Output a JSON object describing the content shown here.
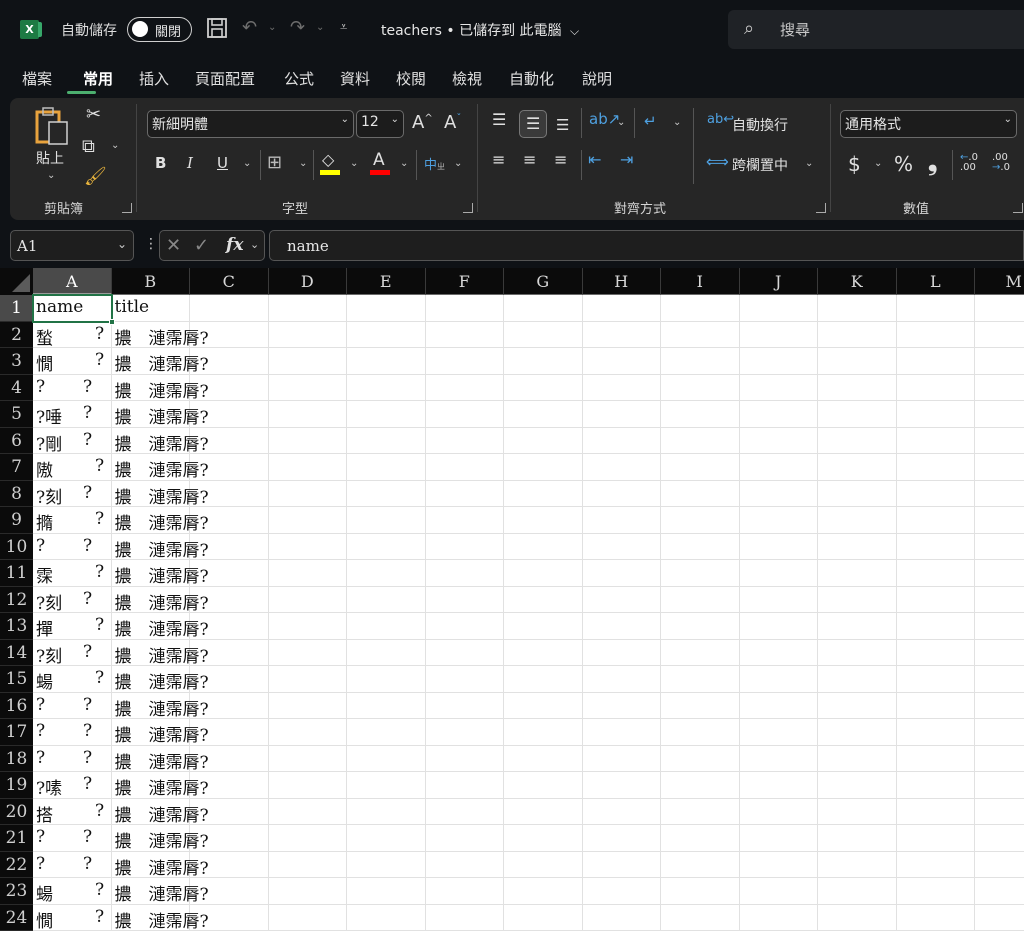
{
  "titlebar": {
    "app_icon": "excel-logo-icon",
    "autosave_label": "自動儲存",
    "autosave_state": "關閉",
    "document_title": "teachers • 已儲存到 此電腦",
    "search_placeholder": "搜尋"
  },
  "menu": {
    "tabs": [
      "檔案",
      "常用",
      "插入",
      "頁面配置",
      "公式",
      "資料",
      "校閱",
      "檢視",
      "自動化",
      "說明"
    ],
    "active": "常用"
  },
  "ribbon": {
    "clipboard": {
      "paste_label": "貼上",
      "group_label": "剪貼簿"
    },
    "font": {
      "font_name": "新細明體",
      "font_size": "12",
      "group_label": "字型",
      "fill_color": "#ffff00",
      "font_color": "#ff0000"
    },
    "alignment": {
      "wrap_text": "自動換行",
      "merge_center": "跨欄置中",
      "group_label": "對齊方式"
    },
    "number": {
      "format": "通用格式",
      "group_label": "數值",
      "currency": "$",
      "percent": "%",
      "comma": "❟"
    }
  },
  "formula_bar": {
    "name_box": "A1",
    "formula": "name"
  },
  "grid": {
    "columns": [
      "A",
      "B",
      "C",
      "D",
      "E",
      "F",
      "G",
      "H",
      "I",
      "J",
      "K",
      "L",
      "M"
    ],
    "selected_column": "A",
    "selected_cell": "A1",
    "header_row": {
      "num": "1",
      "A": "name",
      "B": "title"
    },
    "rows": [
      {
        "num": "2",
        "A": "蝵",
        "A_q": "?",
        "A_q_far": true,
        "B": "擃　漣霈脣?"
      },
      {
        "num": "3",
        "A": "憪",
        "A_q": "?",
        "A_q_far": true,
        "B": "擃　漣霈脣?"
      },
      {
        "num": "4",
        "A": "?",
        "A_q": "?",
        "A_q_far": false,
        "B": "擃　漣霈脣?"
      },
      {
        "num": "5",
        "A": "?唾",
        "A_q": "?",
        "A_q_far": false,
        "B": "擃　漣霈脣?"
      },
      {
        "num": "6",
        "A": "?剛",
        "A_q": "?",
        "A_q_far": false,
        "B": "擃　漣霈脣?"
      },
      {
        "num": "7",
        "A": "隞",
        "A_q": "?",
        "A_q_far": true,
        "B": "擃　漣霈脣?"
      },
      {
        "num": "8",
        "A": "?刻",
        "A_q": "?",
        "A_q_far": false,
        "B": "擃　漣霈脣?"
      },
      {
        "num": "9",
        "A": "撱",
        "A_q": "?",
        "A_q_far": true,
        "B": "擃　漣霈脣?"
      },
      {
        "num": "10",
        "A": "?",
        "A_q": "?",
        "A_q_far": false,
        "B": "擃　漣霈脣?"
      },
      {
        "num": "11",
        "A": "霂",
        "A_q": "?",
        "A_q_far": true,
        "B": "擃　漣霈脣?"
      },
      {
        "num": "12",
        "A": "?刻",
        "A_q": "?",
        "A_q_far": false,
        "B": "擃　漣霈脣?"
      },
      {
        "num": "13",
        "A": "撣",
        "A_q": "?",
        "A_q_far": true,
        "B": "擃　漣霈脣?"
      },
      {
        "num": "14",
        "A": "?刻",
        "A_q": "?",
        "A_q_far": false,
        "B": "擃　漣霈脣?"
      },
      {
        "num": "15",
        "A": "蝪",
        "A_q": "?",
        "A_q_far": true,
        "B": "擃　漣霈脣?"
      },
      {
        "num": "16",
        "A": "?",
        "A_q": "?",
        "A_q_far": false,
        "B": "擃　漣霈脣?"
      },
      {
        "num": "17",
        "A": "?",
        "A_q": "?",
        "A_q_far": false,
        "B": "擃　漣霈脣?"
      },
      {
        "num": "18",
        "A": "?",
        "A_q": "?",
        "A_q_far": false,
        "B": "擃　漣霈脣?"
      },
      {
        "num": "19",
        "A": "?嗉",
        "A_q": "?",
        "A_q_far": false,
        "B": "擃　漣霈脣?"
      },
      {
        "num": "20",
        "A": "搭",
        "A_q": "?",
        "A_q_far": true,
        "B": "擃　漣霈脣?"
      },
      {
        "num": "21",
        "A": "?",
        "A_q": "?",
        "A_q_far": false,
        "B": "擃　漣霈脣?"
      },
      {
        "num": "22",
        "A": "?",
        "A_q": "?",
        "A_q_far": false,
        "B": "擃　漣霈脣?"
      },
      {
        "num": "23",
        "A": "蝪",
        "A_q": "?",
        "A_q_far": true,
        "B": "擃　漣霈脣?"
      },
      {
        "num": "24",
        "A": "憪",
        "A_q": "?",
        "A_q_far": true,
        "B": "擃　漣霈脣?"
      }
    ]
  }
}
